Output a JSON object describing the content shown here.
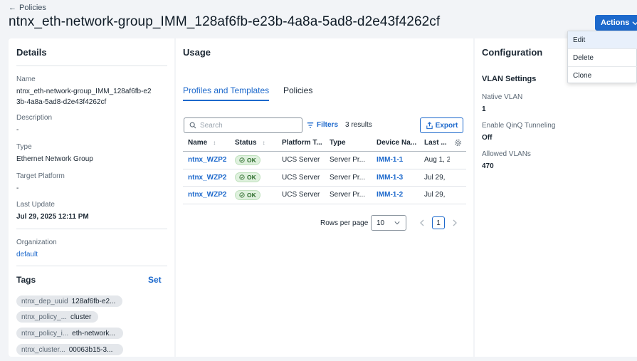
{
  "header": {
    "back_label": "Policies",
    "title": "ntnx_eth-network-group_IMM_128af6fb-e23b-4a8a-5ad8-d2e43f4262cf",
    "actions_label": "Actions"
  },
  "actions_menu": {
    "items": [
      "Edit",
      "Delete",
      "Clone"
    ]
  },
  "details": {
    "title": "Details",
    "name_label": "Name",
    "name_value": "ntnx_eth-network-group_IMM_128af6fb-e23b-4a8a-5ad8-d2e43f4262cf",
    "description_label": "Description",
    "description_value": "-",
    "type_label": "Type",
    "type_value": "Ethernet Network Group",
    "target_platform_label": "Target Platform",
    "target_platform_value": "-",
    "last_update_label": "Last Update",
    "last_update_value": "Jul 29, 2025 12:11 PM",
    "organization_label": "Organization",
    "organization_value": "default",
    "tags_title": "Tags",
    "set_label": "Set",
    "tags": [
      {
        "key": "ntnx_dep_uuid",
        "value": "128af6fb-e2..."
      },
      {
        "key": "ntnx_policy_...",
        "value": "cluster"
      },
      {
        "key": "ntnx_policy_i...",
        "value": "eth-network..."
      },
      {
        "key": "ntnx_cluster...",
        "value": "00063b15-3..."
      }
    ]
  },
  "usage": {
    "title": "Usage",
    "tabs": [
      {
        "label": "Profiles and Templates",
        "active": true
      },
      {
        "label": "Policies",
        "active": false
      }
    ],
    "search_placeholder": "Search",
    "filters_label": "Filters",
    "results_label": "3 results",
    "export_label": "Export",
    "columns": [
      "Name",
      "Status",
      "Platform T...",
      "Type",
      "Device Na...",
      "Last ..."
    ],
    "rows": [
      {
        "name": "ntnx_WZP2",
        "status": "OK",
        "platform": "UCS Server",
        "type": "Server Pr...",
        "device": "IMM-1-1",
        "last": "Aug 1, 2"
      },
      {
        "name": "ntnx_WZP2",
        "status": "OK",
        "platform": "UCS Server",
        "type": "Server Pr...",
        "device": "IMM-1-3",
        "last": "Jul 29,"
      },
      {
        "name": "ntnx_WZP2",
        "status": "OK",
        "platform": "UCS Server",
        "type": "Server Pr...",
        "device": "IMM-1-2",
        "last": "Jul 29,"
      }
    ],
    "rows_per_page_label": "Rows per page",
    "rows_per_page_value": "10",
    "current_page": "1"
  },
  "configuration": {
    "title": "Configuration",
    "vlan_settings_title": "VLAN Settings",
    "native_vlan_label": "Native VLAN",
    "native_vlan_value": "1",
    "qinq_label": "Enable QinQ Tunneling",
    "qinq_value": "Off",
    "allowed_vlans_label": "Allowed VLANs",
    "allowed_vlans_value": "470"
  },
  "colors": {
    "accent": "#1d69cc",
    "ok_green": "#2b6b2a",
    "page_bg": "#f2f4f7"
  }
}
